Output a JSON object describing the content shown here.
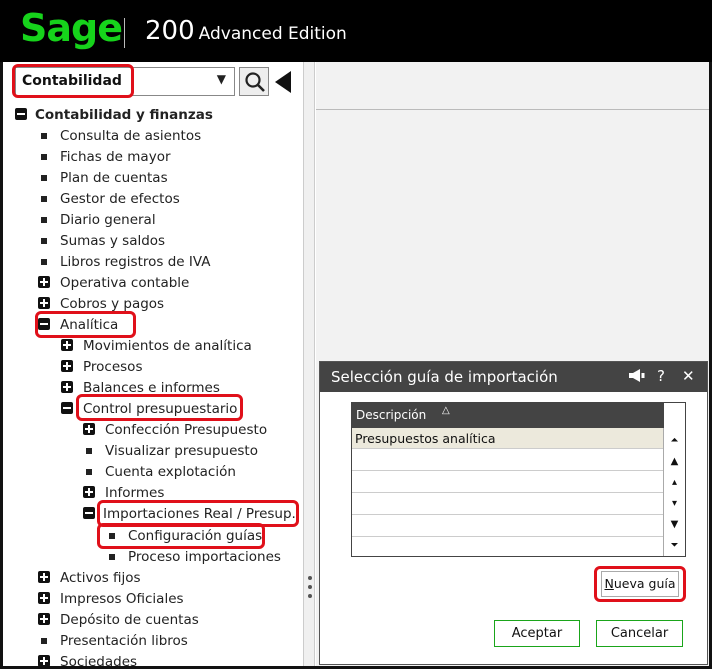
{
  "header": {
    "logo_text": "Sage",
    "product_number": "200",
    "product_edition": "Advanced Edition",
    "logo_color": "#16d31b"
  },
  "sidebar": {
    "module_value": "Contabilidad",
    "tree": {
      "root": "Contabilidad y finanzas",
      "consulta": "Consulta de asientos",
      "fichas": "Fichas de mayor",
      "plan": "Plan de cuentas",
      "gestor": "Gestor de efectos",
      "diario": "Diario general",
      "sumas": "Sumas y saldos",
      "libros": "Libros registros de IVA",
      "operativa": "Operativa contable",
      "cobros": "Cobros y pagos",
      "analitica": "Analítica",
      "movimientos": "Movimientos de analítica",
      "procesos": "Procesos",
      "balances": "Balances e informes",
      "control": "Control presupuestario",
      "confeccion": "Confección Presupuesto",
      "visualizar": "Visualizar presupuesto",
      "cuenta": "Cuenta explotación",
      "informes": "Informes",
      "importaciones": "Importaciones Real / Presup.",
      "configuracion": "Configuración guías",
      "proceso_imp": "Proceso importaciones",
      "activos": "Activos fijos",
      "impresos": "Impresos Oficiales",
      "deposito": "Depósito de cuentas",
      "presentacion": "Presentación libros",
      "sociedades": "Sociedades"
    }
  },
  "dialog": {
    "title": "Selección guía de importación",
    "column_header": "Descripción",
    "rows": [
      "Presupuestos analítica",
      "",
      "",
      "",
      "",
      ""
    ],
    "new_button_u": "N",
    "new_button_rest": "ueva guía",
    "accept": "Aceptar",
    "cancel": "Cancelar",
    "help_glyph": "?",
    "close_glyph": "✕"
  }
}
